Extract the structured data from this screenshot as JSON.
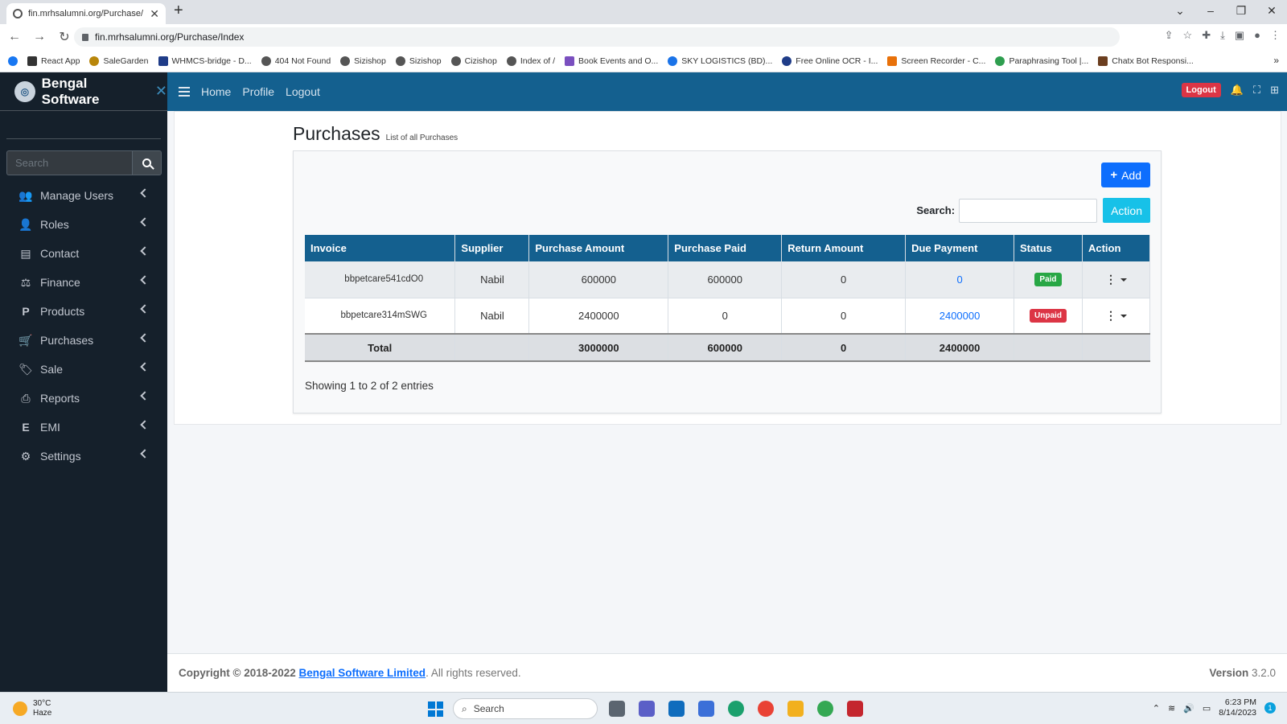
{
  "browser": {
    "tab_title": "fin.mrhsalumni.org/Purchase/Ind",
    "url": "fin.mrhsalumni.org/Purchase/Index",
    "bookmarks": [
      "React App",
      "SaleGarden",
      "WHMCS-bridge - D...",
      "404 Not Found",
      "Sizishop",
      "Sizishop",
      "Cizishop",
      "Index of /",
      "Book Events and O...",
      "SKY LOGISTICS (BD)...",
      "Free Online OCR - I...",
      "Screen Recorder - C...",
      "Paraphrasing Tool |...",
      "Chatx Bot Responsi..."
    ]
  },
  "sidebar": {
    "brand": "Bengal Software",
    "search_placeholder": "Search",
    "items": [
      {
        "label": "Manage Users",
        "icon": "users-icon"
      },
      {
        "label": "Roles",
        "icon": "user-icon"
      },
      {
        "label": "Contact",
        "icon": "address-book-icon"
      },
      {
        "label": "Finance",
        "icon": "balance-scale-icon"
      },
      {
        "label": "Products",
        "icon": "product-p-icon"
      },
      {
        "label": "Purchases",
        "icon": "cart-icon"
      },
      {
        "label": "Sale",
        "icon": "tags-icon"
      },
      {
        "label": "Reports",
        "icon": "print-icon"
      },
      {
        "label": "EMI",
        "icon": "emi-e-icon"
      },
      {
        "label": "Settings",
        "icon": "gear-icon"
      }
    ]
  },
  "header": {
    "home": "Home",
    "profile": "Profile",
    "logout": "Logout",
    "logout_button": "Logout"
  },
  "page": {
    "title": "Purchases",
    "subtitle": "List of all Purchases",
    "add_label": "Add",
    "search_label": "Search:",
    "action_label": "Action",
    "entries_info": "Showing 1 to 2 of 2 entries"
  },
  "table": {
    "headers": [
      "Invoice",
      "Supplier",
      "Purchase Amount",
      "Purchase Paid",
      "Return Amount",
      "Due Payment",
      "Status",
      "Action"
    ],
    "rows": [
      {
        "invoice": "bbpetcare541cdO0",
        "supplier": "Nabil",
        "purchase_amount": "600000",
        "purchase_paid": "600000",
        "return_amount": "0",
        "due_payment": "0",
        "status": "Paid"
      },
      {
        "invoice": "bbpetcare314mSWG",
        "supplier": "Nabil",
        "purchase_amount": "2400000",
        "purchase_paid": "0",
        "return_amount": "0",
        "due_payment": "2400000",
        "status": "Unpaid"
      }
    ],
    "total": {
      "label": "Total",
      "purchase_amount": "3000000",
      "purchase_paid": "600000",
      "return_amount": "0",
      "due_payment": "2400000"
    }
  },
  "footer": {
    "copyright": "Copyright © 2018-2022",
    "company": "Bengal Software Limited",
    "rights": ". All rights reserved.",
    "version_label": "Version",
    "version": "3.2.0"
  },
  "taskbar": {
    "temp": "30°C",
    "weather": "Haze",
    "search": "Search",
    "time": "6:23 PM",
    "date": "8/14/2023",
    "notifications": "1"
  },
  "colors": {
    "header": "#14608f",
    "sidebar": "#15202b",
    "primary": "#0d6efd",
    "info": "#17c1e8",
    "success": "#28a745",
    "danger": "#dc3545"
  }
}
